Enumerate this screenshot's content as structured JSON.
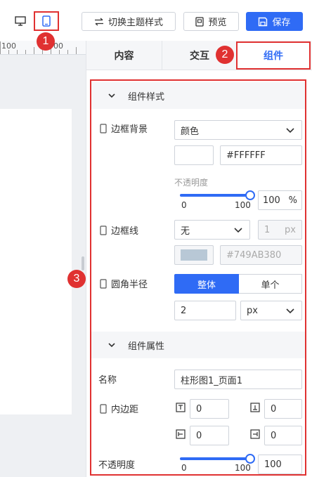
{
  "toolbar": {
    "desktop_icon": "desktop-icon",
    "mobile_icon": "mobile-icon",
    "theme_label": "切换主题样式",
    "preview_label": "预览",
    "save_label": "保存"
  },
  "badges": {
    "b1": "1",
    "b2": "2",
    "b3": "3"
  },
  "ruler": {
    "left": "100",
    "right": "00"
  },
  "tabs": [
    {
      "label": "内容"
    },
    {
      "label": "交互"
    },
    {
      "label": "组件",
      "active": true
    }
  ],
  "style_section": {
    "title": "组件样式",
    "border_bg": {
      "label": "边框背景",
      "type": "颜色",
      "color_value": "#FFFFFF"
    },
    "opacity": {
      "label": "不透明度",
      "min": "0",
      "max": "100",
      "value": "100",
      "unit": "%",
      "fraction": 1.0
    },
    "border_line": {
      "label": "边框线",
      "style": "无",
      "width": "1",
      "unit": "px",
      "color_value": "#749AB380",
      "swatch_color": "#b8c8d6"
    },
    "corner_radius": {
      "label": "圆角半径",
      "opt_whole": "整体",
      "opt_each": "单个",
      "value": "2",
      "unit": "px"
    }
  },
  "attr_section": {
    "title": "组件属性",
    "name": {
      "label": "名称",
      "value": "柱形图1_页面1"
    },
    "padding": {
      "label": "内边距",
      "top": "0",
      "bottom": "0",
      "left": "0",
      "right": "0"
    },
    "opacity": {
      "label": "不透明度",
      "min": "0",
      "max": "100",
      "value": "100",
      "fraction": 1.0
    }
  },
  "colors": {
    "accent": "#2f6bf5",
    "highlight": "#e03131"
  }
}
